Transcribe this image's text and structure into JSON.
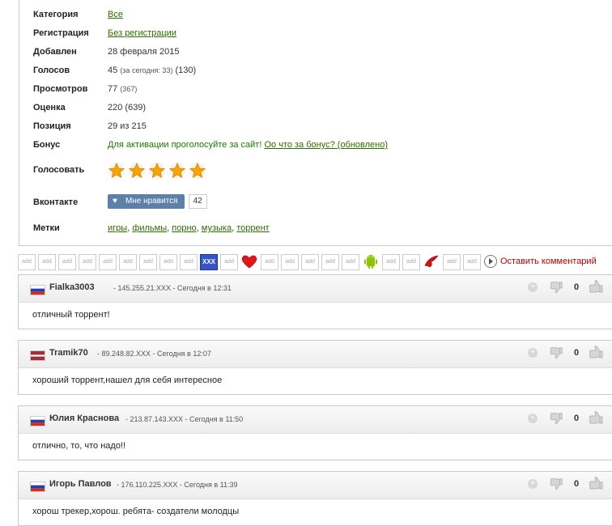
{
  "info": {
    "rows": [
      {
        "label": "Категория",
        "value": "Все"
      },
      {
        "label": "Регистрация",
        "value": "Без регистрации"
      },
      {
        "label": "Добавлен",
        "value": "28 февраля 2015"
      },
      {
        "label": "Голосов",
        "value_main": "45",
        "value_small": "(за сегодня: 33)",
        "value_extra": "(130)"
      },
      {
        "label": "Просмотров",
        "value_main": "77",
        "value_small": "(367)"
      },
      {
        "label": "Оценка",
        "value": "220 (639)"
      },
      {
        "label": "Позиция",
        "value": "29 из 215"
      },
      {
        "label": "Бонус",
        "value_text": "Для активации проголосуйте за сайт!",
        "value_link": "Оо что за бонус? (обновлено)"
      },
      {
        "label": "Голосовать",
        "stars": 5
      },
      {
        "label": "Вконтакте",
        "button": "Мне нравится",
        "count": "42"
      },
      {
        "label": "Метки",
        "tags": [
          "игры",
          "фильмы",
          "порно",
          "музыка",
          "торрент"
        ]
      }
    ]
  },
  "share_bar": {
    "add_label": "add",
    "xxx_label": "XXX",
    "leave_comment": "Оставить комментарий"
  },
  "comments": [
    {
      "author": "Fialka3003",
      "meta": "- 145.255.21.XXX - Сегодня в 12:31",
      "text": "отличный торрент!",
      "score": "0",
      "flag": "russia"
    },
    {
      "author": "Tramik70",
      "meta": "- 89.248.82.XXX - Сегодня в 12:07",
      "text": "хороший торрент,нашел для себя интересное",
      "score": "0",
      "flag": "latvia"
    },
    {
      "author": "Юлия Краснова",
      "meta": "- 213.87.143.XXX - Сегодня в 11:50",
      "text": "отлично, то, что надо!!",
      "score": "0",
      "flag": "russia"
    },
    {
      "author": "Игорь Павлов",
      "meta": "- 176.110.225.XXX - Сегодня в 11:39",
      "text": "хорош трекер,хорош. ребята- создатели молодцы",
      "score": "0",
      "flag": "russia"
    }
  ],
  "colors": {
    "link": "#2e6d00",
    "vk_button": "#5d80a8",
    "leave_comment": "#c00000",
    "star": "#f5a500"
  }
}
